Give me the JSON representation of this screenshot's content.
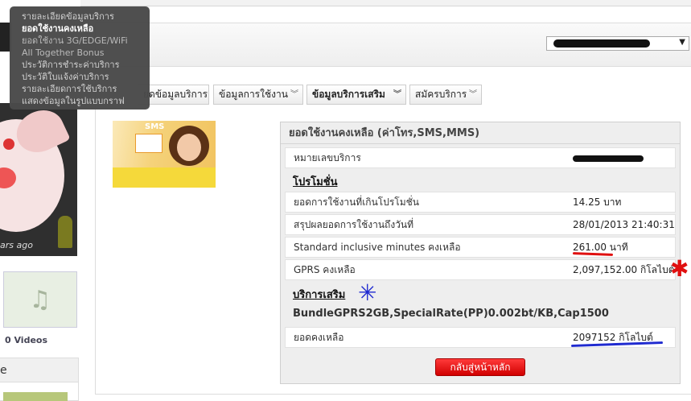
{
  "left": {
    "years_ago": "ars ago",
    "videos_count": "0 Videos",
    "box_title": "e"
  },
  "menu": {
    "items": [
      {
        "label": "รายละเอียดข้อมูลบริการ",
        "active": false
      },
      {
        "label": "ยอดใช้งานคงเหลือ",
        "active": true
      },
      {
        "label": "ยอดใช้งาน 3G/EDGE/WiFi",
        "active": false
      },
      {
        "label": "All Together Bonus",
        "active": false
      },
      {
        "label": "ประวัติการชำระค่าบริการ",
        "active": false
      },
      {
        "label": "ประวัติใบแจ้งค่าบริการ",
        "active": false
      },
      {
        "label": "รายละเอียดการใช้บริการ",
        "active": false
      },
      {
        "label": "แสดงข้อมูลในรูปแบบกราฟ",
        "active": false
      }
    ]
  },
  "tabs": [
    {
      "label": "ยดข้อมูลบริการ",
      "active": false
    },
    {
      "label": "ข้อมูลการใช้งาน",
      "active": false
    },
    {
      "label": "ข้อมูลบริการเสริม",
      "active": true
    },
    {
      "label": "สมัครบริการ",
      "active": false
    }
  ],
  "panel": {
    "title": "ยอดใช้งานคงเหลือ (ค่าโทร,SMS,MMS)",
    "service_number_label": "หมายเลขบริการ",
    "promotion_heading": "โปรโมชั่น",
    "rows": [
      {
        "label": "ยอดการใช้งานที่เกินโปรโมชั่น",
        "value": "14.25 บาท"
      },
      {
        "label": "สรุปผลยอดการใช้งานถึงวันที่",
        "value": "28/01/2013 21:40:31"
      },
      {
        "label": "Standard inclusive minutes คงเหลือ",
        "value": "261.00 นาที"
      },
      {
        "label": "GPRS คงเหลือ",
        "value": "2,097,152.00 กิโลไบต์"
      }
    ],
    "addon_heading": "บริการเสริม",
    "bundle_name": "BundleGPRS2GB,SpecialRate(PP)0.002bt/KB,Cap1500",
    "balance_label": "ยอดคงเหลือ",
    "balance_value": "2097152 กิโลไบต์",
    "back_button": "กลับสู่หน้าหลัก"
  },
  "promo_image": {
    "badge": "SMS"
  },
  "icons": {
    "dropdown": "chevron-double-down-icon",
    "select_arrow": "triangle-down-icon"
  },
  "colors": {
    "menu_bg": "#4a4a4a",
    "button": "#e00000",
    "annotation_red": "#e01010",
    "annotation_blue": "#1f2ad0"
  }
}
